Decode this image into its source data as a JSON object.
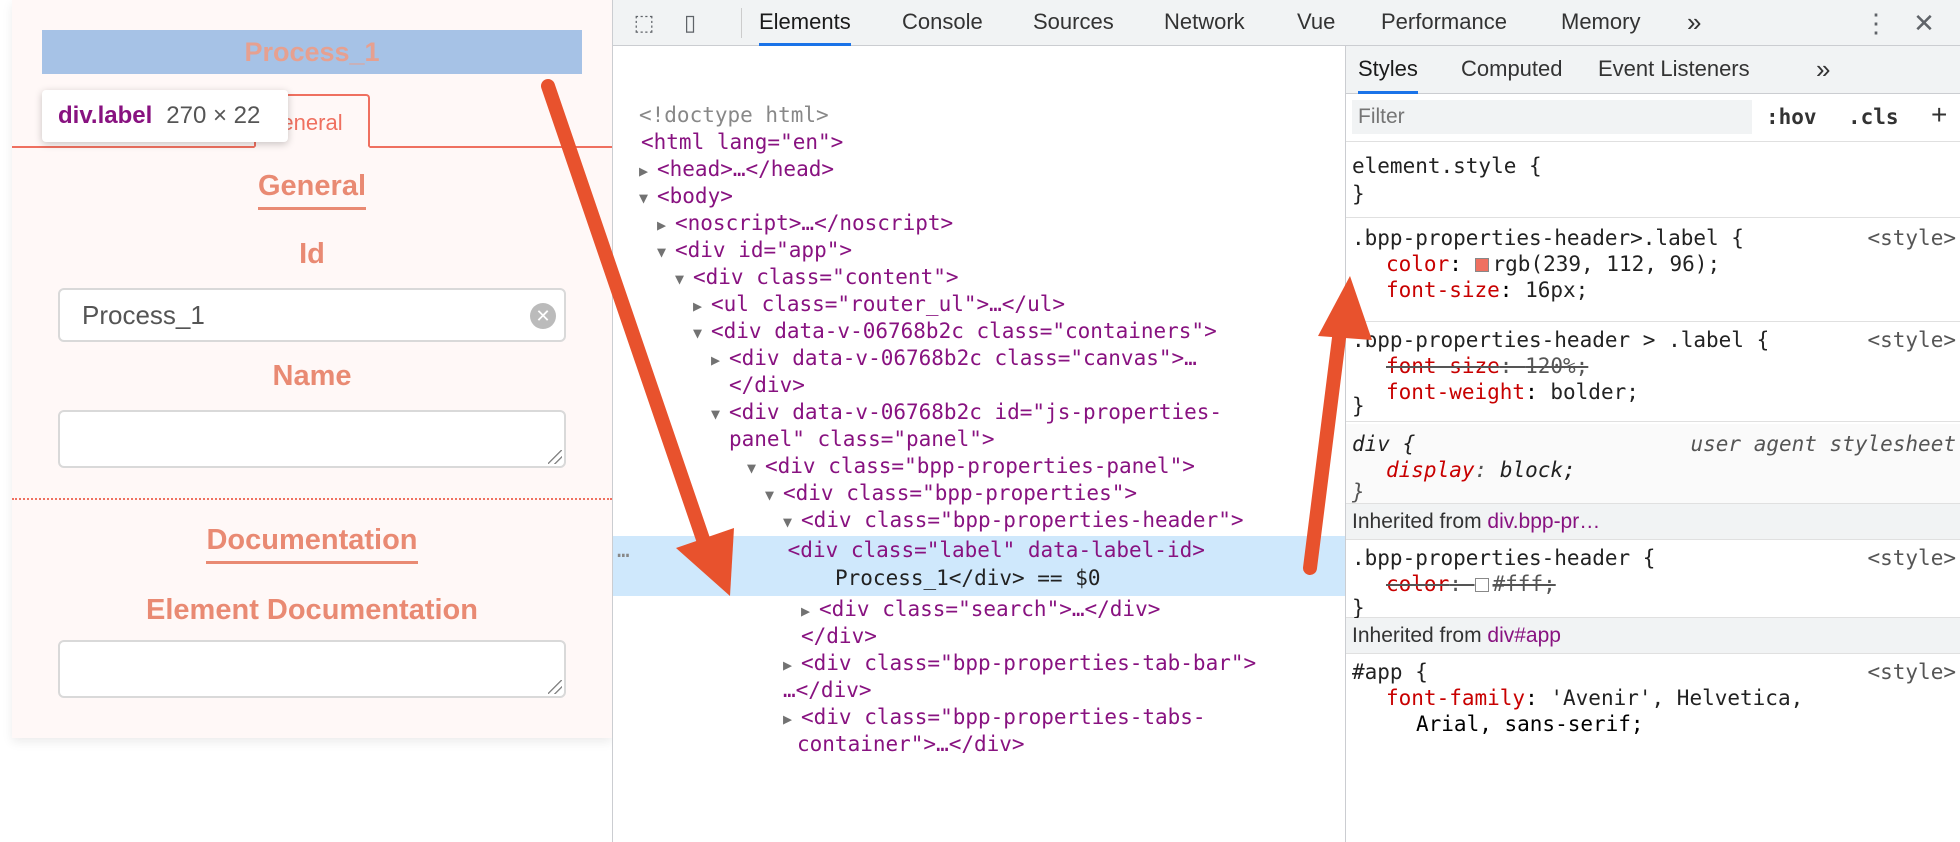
{
  "app": {
    "header_label": "Process_1",
    "tooltip": {
      "tag": "div.label",
      "dims": "270 × 22"
    },
    "tab_general": "eneral",
    "section_general": "General",
    "id_label": "Id",
    "id_value": "Process_1",
    "name_label": "Name",
    "section_documentation": "Documentation",
    "element_doc_label": "Element Documentation"
  },
  "devtools": {
    "tabs": [
      "Elements",
      "Console",
      "Sources",
      "Network",
      "Vue",
      "Performance",
      "Memory"
    ],
    "more_tabs": "»",
    "elements_rows": [
      {
        "text": "<!doctype html>"
      },
      {
        "text": "<html lang=\"en\">"
      },
      {
        "text": "<head>…</head>"
      },
      {
        "text": "<body>"
      },
      {
        "text": "<noscript>…</noscript>"
      },
      {
        "text": "<div id=\"app\">"
      },
      {
        "text": "<div class=\"content\">"
      },
      {
        "text": "<ul class=\"router_ul\">…</ul>"
      },
      {
        "text": "<div data-v-06768b2c class=\"containers\">"
      },
      {
        "text": "<div data-v-06768b2c class=\"canvas\">…"
      },
      {
        "text": "</div>"
      },
      {
        "text": "<div data-v-06768b2c id=\"js-properties-"
      },
      {
        "text": "panel\" class=\"panel\">"
      },
      {
        "text": "<div class=\"bpp-properties-panel\">"
      },
      {
        "text": "<div class=\"bpp-properties\">"
      },
      {
        "text": "<div class=\"bpp-properties-header\">"
      },
      {
        "text": "<div class=\"label\" data-label-id>"
      },
      {
        "text": "Process_1</div> == $0"
      },
      {
        "text": "<div class=\"search\">…</div>"
      },
      {
        "text": "</div>"
      },
      {
        "text": "<div class=\"bpp-properties-tab-bar\">"
      },
      {
        "text": "…</div>"
      },
      {
        "text": "<div class=\"bpp-properties-tabs-"
      },
      {
        "text": "container\">…</div>"
      }
    ],
    "row_ellipsis": "…",
    "styles": {
      "tabs": [
        "Styles",
        "Computed",
        "Event Listeners"
      ],
      "more": "»",
      "filter_placeholder": "Filter",
      "hov": ":hov",
      "cls": ".cls",
      "plus": "+",
      "element_style": "element.style {",
      "close_brace": "}",
      "rule1_selector": ".bpp-properties-header>.label {",
      "rule1_src": "<style>",
      "rule1_p1_name": "color",
      "rule1_p1_value": "rgb(239, 112, 96);",
      "rule1_p1_color": "#ef7060",
      "rule1_p2_name": "font-size",
      "rule1_p2_value": "16px;",
      "rule2_selector": ".bpp-properties-header > .label {",
      "rule2_src": "<style>",
      "rule2_p1_name": "font-size",
      "rule2_p1_value": "120%;",
      "rule2_p2_name": "font-weight",
      "rule2_p2_value": "bolder;",
      "rule3_selector": "div {",
      "rule3_src": "user agent stylesheet",
      "rule3_p1_name": "display",
      "rule3_p1_value": "block;",
      "inherit1_prefix": "Inherited from ",
      "inherit1_target": "div.bpp-pr…",
      "rule4_selector": ".bpp-properties-header {",
      "rule4_src": "<style>",
      "rule4_p1_name": "color",
      "rule4_p1_value": "#fff;",
      "rule4_p1_color": "#ffffff",
      "inherit2_prefix": "Inherited from ",
      "inherit2_target": "div#app",
      "rule5_selector": "#app {",
      "rule5_src": "<style>",
      "rule5_p1_name": "font-family",
      "rule5_p1_value": "'Avenir', Helvetica,",
      "rule5_p1_cont": "Arial, sans-serif;"
    }
  },
  "colors": {
    "accent": "#ef7060",
    "annotation_arrow": "#e8522d",
    "selection": "#cfe8fc"
  }
}
